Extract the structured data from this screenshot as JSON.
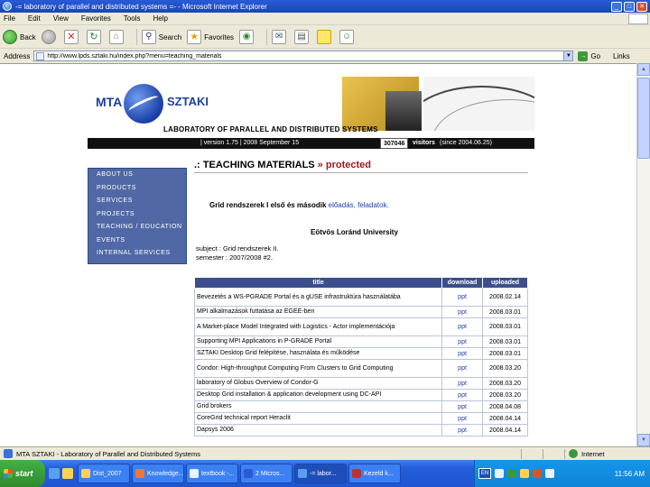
{
  "window": {
    "title": "-= laboratory of parallel and distributed systems =- - Microsoft Internet Explorer"
  },
  "menu": [
    "File",
    "Edit",
    "View",
    "Favorites",
    "Tools",
    "Help"
  ],
  "toolbar": {
    "back": "Back",
    "search": "Search",
    "favorites": "Favorites"
  },
  "address": {
    "label": "Address",
    "url": "http://www.lpds.sztaki.hu/index.php?menu=teaching_materials",
    "go": "Go",
    "links": "Links"
  },
  "site": {
    "logo_left": "MTA",
    "logo_right": "SZTAKI",
    "lab_title": "LABORATORY OF PARALLEL AND DISTRIBUTED SYSTEMS",
    "version": "| version 1.75 | 2008 September 15",
    "visitor_count": "307046",
    "visitor_label": "visitors",
    "visitor_since": "(since 2004.06.25)"
  },
  "sidebar": {
    "items": [
      "ABOUT US",
      "PRODUCTS",
      "SERVICES",
      "PROJECTS",
      "TEACHING / EDUCATION",
      "EVENTS",
      "INTERNAL SERVICES"
    ]
  },
  "content": {
    "title_prefix": ".: TEACHING MATERIALS",
    "title_suffix": " » protected",
    "grid_text": "Grid rendszerek I első és második",
    "grid_link": "előadás, feladatok.",
    "university": "Eötvös Loránd University",
    "subject": "subject : Grid rendszerek II.",
    "semester": "semester : 2007/2008    #2."
  },
  "table": {
    "headers": [
      "title",
      "download",
      "uploaded"
    ],
    "rows": [
      {
        "title": "Bevezetés a WS-PGRADE Portal és a gUSE infrastruktúra használatába",
        "download": "ppt",
        "uploaded": "2008.02.14"
      },
      {
        "title": "MPI alkalmazások futtatása az EGEE-ben",
        "download": "ppt",
        "uploaded": "2008.03.01"
      },
      {
        "title": "A Market-place Model Integrated with Logistics - Actor implementációja",
        "download": "ppt",
        "uploaded": "2008.03.01"
      },
      {
        "title": "Supporting MPI Applications in P-GRADE Portal",
        "download": "ppt",
        "uploaded": "2008.03.01"
      },
      {
        "title": "SZTAKI Desktop Grid felépítése, használata és működése",
        "download": "ppt",
        "uploaded": "2008.03.01"
      },
      {
        "title": "Condor: High-throughput Computing From Clusters to Grid Computing",
        "download": "ppt",
        "uploaded": "2008.03.20"
      },
      {
        "title": "laboratory of Globus Overview of Condor-G",
        "download": "ppt",
        "uploaded": "2008.03.20"
      },
      {
        "title": "Desktop Grid installation & application development using DC-API",
        "download": "ppt",
        "uploaded": "2008.03.20"
      },
      {
        "title": "Grid brokers",
        "download": "ppt",
        "uploaded": "2008.04.08"
      },
      {
        "title": "CoreGrid technical report Heraclit",
        "download": "ppt",
        "uploaded": "2008.04.14"
      },
      {
        "title": "Dapsys 2006",
        "download": "ppt",
        "uploaded": "2008.04.14"
      }
    ]
  },
  "status": {
    "text": "MTA SZTAKI - Laboratory of Parallel and Distributed Systems",
    "zone": "Internet"
  },
  "taskbar": {
    "start": "start",
    "tasks": [
      "Dist_2007",
      "Knowledge...",
      "textbook -...",
      "2 Micros...",
      "-= labor...",
      "Kezeld k..."
    ],
    "language": "EN",
    "clock": "11:56 AM"
  }
}
